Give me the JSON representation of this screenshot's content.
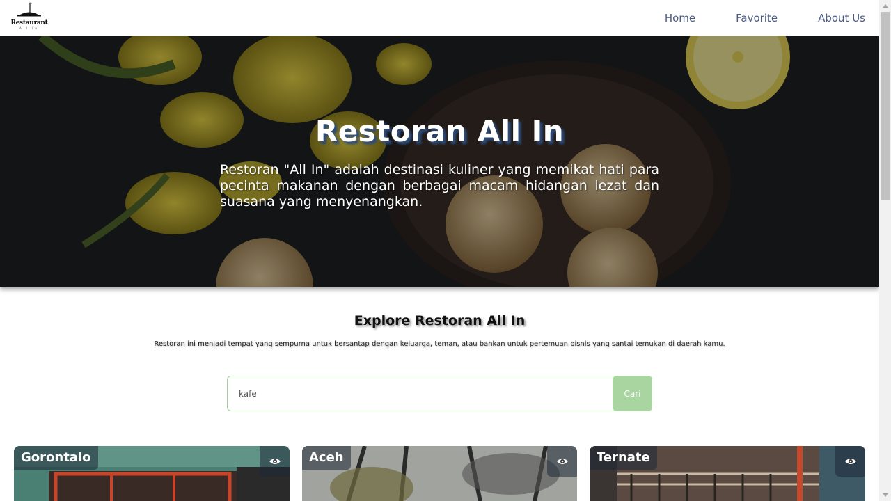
{
  "header": {
    "logo_text": "Restaurant",
    "logo_sub": "All In",
    "nav": [
      {
        "label": "Home"
      },
      {
        "label": "Favorite"
      },
      {
        "label": "About Us"
      }
    ]
  },
  "hero": {
    "title": "Restoran All In",
    "description": "Restoran \"All In\" adalah destinasi kuliner yang memikat hati para pecinta makanan dengan berbagai macam hidangan lezat dan suasana yang menyenangkan."
  },
  "explore": {
    "title": "Explore Restoran All In",
    "description": "Restoran ini menjadi tempat yang sempurna untuk bersantap dengan keluarga, teman, atau bahkan untuk pertemuan bisnis yang santai temukan di daerah kamu."
  },
  "search": {
    "value": "kafe",
    "button_label": "Cari"
  },
  "cards": [
    {
      "city": "Gorontalo",
      "icon": "eye-icon"
    },
    {
      "city": "Aceh",
      "icon": "eye-icon"
    },
    {
      "city": "Ternate",
      "icon": "eye-icon"
    }
  ],
  "colors": {
    "nav_text": "#4a5a85",
    "search_border": "#9fcf95",
    "search_button": "#a8d5a0",
    "title_shadow": "#2c4b7a"
  }
}
